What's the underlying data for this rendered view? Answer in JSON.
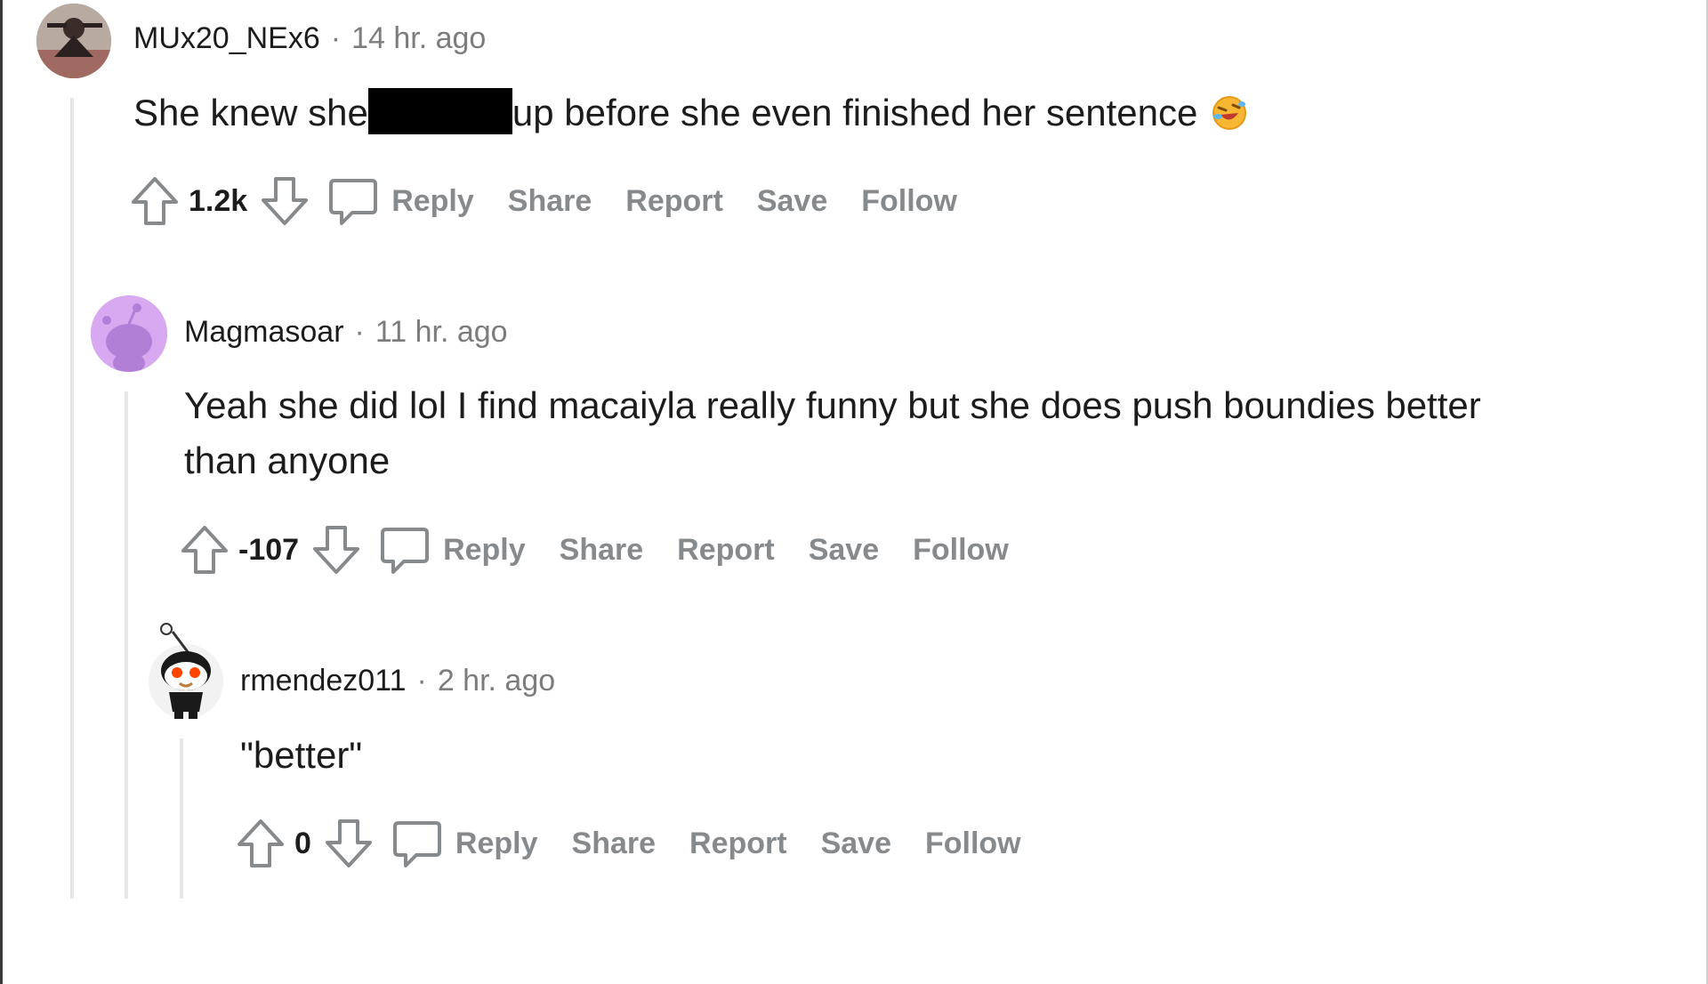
{
  "comments": [
    {
      "author": "MUx20_NEx6",
      "separator": "·",
      "time": "14 hr. ago",
      "body_before": "She knew she",
      "body_after": "up before she even finished her sentence",
      "emoji": "rolling-on-floor-laughing-emoji",
      "score": "1.2k",
      "actions": {
        "reply": "Reply",
        "share": "Share",
        "report": "Report",
        "save": "Save",
        "follow": "Follow"
      }
    },
    {
      "author": "Magmasoar",
      "separator": "·",
      "time": "11 hr. ago",
      "body_line1": "Yeah she did lol I find macaiyla really funny but she does push boundies better",
      "body_line2": "than anyone",
      "score": "-107",
      "actions": {
        "reply": "Reply",
        "share": "Share",
        "report": "Report",
        "save": "Save",
        "follow": "Follow"
      }
    },
    {
      "author": "rmendez011",
      "separator": "·",
      "time": "2 hr. ago",
      "body": "\"better\"",
      "score": "0",
      "actions": {
        "reply": "Reply",
        "share": "Share",
        "report": "Report",
        "save": "Save",
        "follow": "Follow"
      }
    }
  ],
  "colors": {
    "text": "#1c1c1c",
    "muted": "#7c7c7c",
    "action": "#878a8c",
    "thread_line": "#e6e6e6",
    "avatar2": "#d8a8f0"
  }
}
